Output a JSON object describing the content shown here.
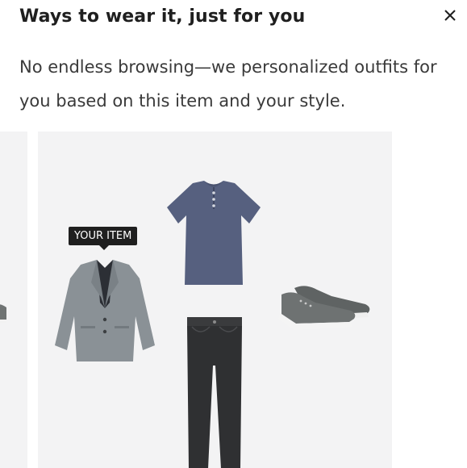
{
  "modal": {
    "title": "Ways to wear it, just for you",
    "subtitle": "No endless browsing—we personalized outfits for you based on this item and your style."
  },
  "outfit": {
    "tag_label": "YOUR ITEM",
    "items": [
      {
        "name": "gray-blazer-image",
        "color": "#8a9196"
      },
      {
        "name": "navy-henley-tee-image",
        "color": "#56607f"
      },
      {
        "name": "black-jeans-image",
        "color": "#2f3032"
      },
      {
        "name": "gray-sneakers-image",
        "color": "#6e7272"
      }
    ]
  }
}
